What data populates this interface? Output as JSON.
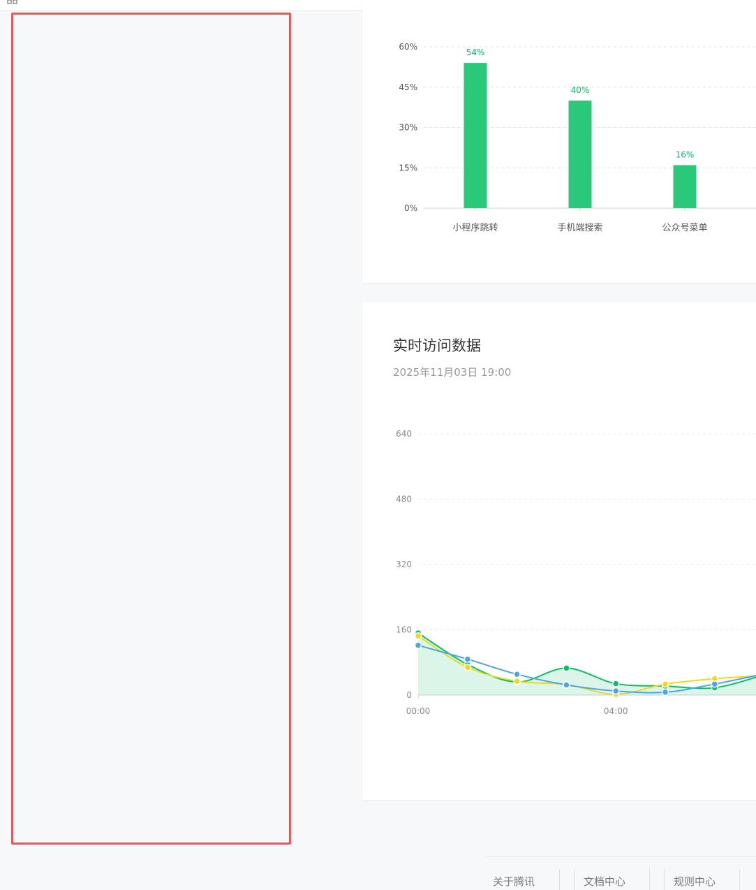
{
  "charts": {
    "sources": {
      "type": "bar",
      "categories": [
        "小程序跳转",
        "手机端搜索",
        "公众号菜单"
      ],
      "values": [
        54,
        40,
        16
      ],
      "value_labels": [
        "54%",
        "40%",
        "16%"
      ],
      "ylim": [
        0,
        60
      ],
      "y_ticks": [
        "0%",
        "15%",
        "30%",
        "45%",
        "60%"
      ],
      "grid": true,
      "color": "#2ac97a"
    },
    "realtime": {
      "type": "line",
      "title": "实时访问数据",
      "subtitle": "2025年11月03日 19:00",
      "x_tick_labels": [
        "00:00",
        "04:00"
      ],
      "x": [
        0,
        1,
        2,
        3,
        4,
        5,
        6,
        7
      ],
      "ylim": [
        0,
        640
      ],
      "y_ticks": [
        "0",
        "160",
        "320",
        "480",
        "640"
      ],
      "grid": true,
      "series": [
        {
          "color": "#07c160",
          "values": [
            152,
            75,
            32,
            66,
            28,
            22,
            18,
            50
          ],
          "area": true
        },
        {
          "color": "#f0d91a",
          "values": [
            145,
            68,
            34,
            26,
            2,
            27,
            40,
            48
          ]
        },
        {
          "color": "#4da5e6",
          "values": [
            122,
            88,
            51,
            25,
            10,
            7,
            27,
            52
          ]
        }
      ]
    }
  },
  "footer": {
    "links": [
      "关于腾讯",
      "文档中心",
      "规则中心"
    ]
  },
  "colors": {
    "highlight_border": "#e85a5a",
    "accent": "#2ac97a"
  }
}
